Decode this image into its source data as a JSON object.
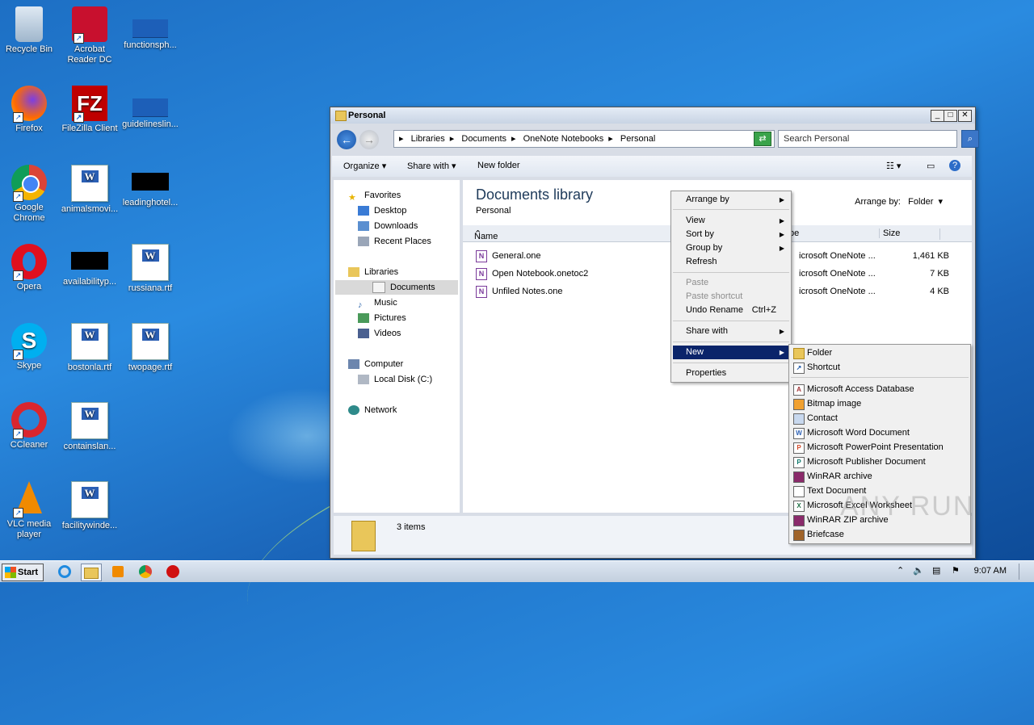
{
  "desktop": {
    "icons": [
      {
        "label": "Recycle Bin",
        "icon": "recycle-bin-icon"
      },
      {
        "label": "Acrobat Reader DC",
        "icon": "acrobat-icon"
      },
      {
        "label": "functionsph...",
        "icon": "document-icon"
      },
      {
        "label": "Firefox",
        "icon": "firefox-icon"
      },
      {
        "label": "FileZilla Client",
        "icon": "filezilla-icon"
      },
      {
        "label": "guidelineslin...",
        "icon": "document-icon"
      },
      {
        "label": "Google Chrome",
        "icon": "chrome-icon"
      },
      {
        "label": "animalsmovi...",
        "icon": "word-doc-icon"
      },
      {
        "label": "leadinghotel...",
        "icon": "black-file-icon"
      },
      {
        "label": "Opera",
        "icon": "opera-icon"
      },
      {
        "label": "availabilityp...",
        "icon": "black-file-icon"
      },
      {
        "label": "russiana.rtf",
        "icon": "word-doc-icon"
      },
      {
        "label": "Skype",
        "icon": "skype-icon"
      },
      {
        "label": "bostonla.rtf",
        "icon": "word-doc-icon"
      },
      {
        "label": "twopage.rtf",
        "icon": "word-doc-icon"
      },
      {
        "label": "CCleaner",
        "icon": "ccleaner-icon"
      },
      {
        "label": "containslan...",
        "icon": "word-doc-icon"
      },
      {
        "label": "VLC media player",
        "icon": "vlc-icon"
      },
      {
        "label": "facilitywinde...",
        "icon": "word-doc-icon"
      }
    ]
  },
  "window": {
    "title": "Personal",
    "breadcrumb": [
      "Libraries",
      "Documents",
      "OneNote Notebooks",
      "Personal"
    ],
    "search_placeholder": "Search Personal",
    "toolbar": {
      "organize": "Organize",
      "share_with": "Share with",
      "new_folder": "New folder"
    },
    "nav": {
      "favorites": "Favorites",
      "desktop": "Desktop",
      "downloads": "Downloads",
      "recent": "Recent Places",
      "libraries": "Libraries",
      "documents": "Documents",
      "music": "Music",
      "pictures": "Pictures",
      "videos": "Videos",
      "computer": "Computer",
      "local_disk": "Local Disk (C:)",
      "network": "Network"
    },
    "library_title": "Documents library",
    "library_sub": "Personal",
    "arrange_by_label": "Arrange by:",
    "arrange_by_value": "Folder",
    "columns": {
      "name": "Name",
      "type": "pe",
      "size": "Size"
    },
    "files": [
      {
        "name": "General.one",
        "type": "icrosoft OneNote ...",
        "size": "1,461 KB"
      },
      {
        "name": "Open Notebook.onetoc2",
        "type": "icrosoft OneNote ...",
        "size": "7 KB"
      },
      {
        "name": "Unfiled Notes.one",
        "type": "icrosoft OneNote ...",
        "size": "4 KB"
      }
    ],
    "status": "3 items"
  },
  "context_menu": {
    "arrange_by": "Arrange by",
    "view": "View",
    "sort_by": "Sort by",
    "group_by": "Group by",
    "refresh": "Refresh",
    "paste": "Paste",
    "paste_shortcut": "Paste shortcut",
    "undo_rename": "Undo Rename",
    "undo_shortcut": "Ctrl+Z",
    "share_with": "Share with",
    "new": "New",
    "properties": "Properties"
  },
  "new_submenu": [
    {
      "label": "Folder"
    },
    {
      "label": "Shortcut"
    },
    {
      "label": "Microsoft Access Database"
    },
    {
      "label": "Bitmap image"
    },
    {
      "label": "Contact"
    },
    {
      "label": "Microsoft Word Document"
    },
    {
      "label": "Microsoft PowerPoint Presentation"
    },
    {
      "label": "Microsoft Publisher Document"
    },
    {
      "label": "WinRAR archive"
    },
    {
      "label": "Text Document"
    },
    {
      "label": "Microsoft Excel Worksheet"
    },
    {
      "label": "WinRAR ZIP archive"
    },
    {
      "label": "Briefcase"
    }
  ],
  "taskbar": {
    "start": "Start",
    "clock": "9:07 AM"
  },
  "watermark": "ANY RUN"
}
